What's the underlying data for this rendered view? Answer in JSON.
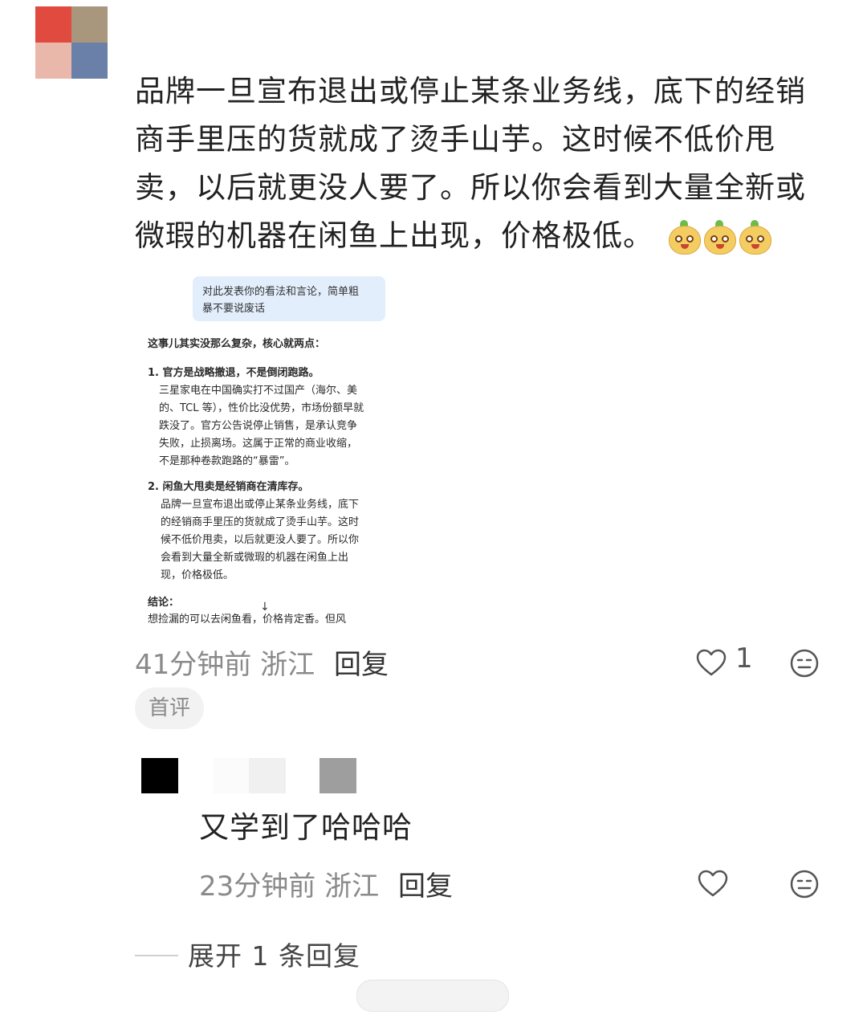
{
  "comment": {
    "text": "品牌一旦宣布退出或停止某条业务线，底下的经销商手里压的货就成了烫手山芋。这时候不低价甩卖，以后就更没人要了。所以你会看到大量全新或微瑕的机器在闲鱼上出现，价格极低。",
    "emoji_names": [
      "doge-fruit-emoji",
      "doge-fruit-emoji",
      "doge-fruit-emoji"
    ],
    "avatar_colors": [
      "#e04a3f",
      "#a8977d",
      "#eab8aa",
      "#6b80a8"
    ],
    "time": "41分钟前 浙江",
    "reply_label": "回复",
    "like_count": "1",
    "badge": "首评"
  },
  "screenshot": {
    "prompt": "对此发表你的看法和言论，简单粗暴不要说废话",
    "prompt_lines": [
      "对此发表你的看法和言论，简单粗",
      "暴不要说废话"
    ],
    "lines": [
      "这事儿其实没那么复杂，核心就两点：",
      "1. 官方是战略撤退，不是倒闭跑路。",
      "三星家电在中国确实打不过国产（海尔、美",
      "的、TCL 等），性价比没优势，市场份额早就",
      "跌没了。官方公告说停止销售，是承认竞争",
      "失败，止损离场。这属于正常的商业收缩，",
      "不是那种卷款跑路的“暴雷”。",
      "2. 闲鱼大甩卖是经销商在清库存。",
      "品牌一旦宣布退出或停止某条业务线，底下",
      "的经销商手里压的货就成了烫手山芋。这时",
      "候不低价甩卖，以后就更没人要了。所以你",
      "会看到大量全新或微瑕的机器在闲鱼上出",
      "现，价格极低。",
      "结论：",
      "想捡漏的可以去闲鱼看，价格肯定香。但风"
    ]
  },
  "reply": {
    "text": "又学到了哈哈哈",
    "avatar_colors": [
      "#000000",
      "#fbfbfb",
      "#f0f0f0",
      "#9e9e9e"
    ],
    "time": "23分钟前 浙江",
    "reply_label": "回复"
  },
  "expand_label": "展开 1 条回复"
}
